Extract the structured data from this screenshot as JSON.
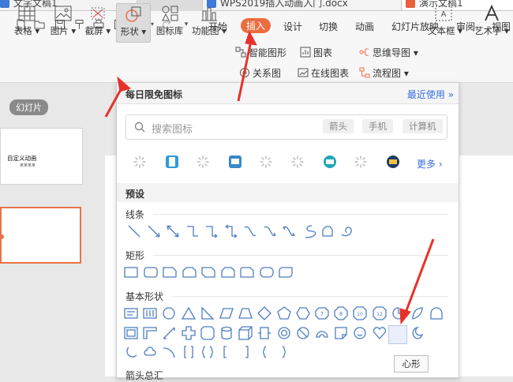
{
  "tabs": [
    {
      "label": "文字文稿1",
      "active": false
    },
    {
      "label": "WPS2019插入动画入门.docx",
      "active": false
    },
    {
      "label": "演示文稿1",
      "active": true
    }
  ],
  "menu": [
    "开始",
    "插入",
    "设计",
    "切换",
    "动画",
    "幻灯片放映",
    "审阅",
    "视图"
  ],
  "menu_active": "插入",
  "ribbon": {
    "table": "表格",
    "picture": "图片",
    "screenshot": "截屏",
    "shape": "形状",
    "icon_lib": "图标库",
    "function_chart": "功能图",
    "smart_graphic": "智能图形",
    "chart": "图表",
    "relation_chart": "关系图",
    "online_chart": "在线图表",
    "mindmap": "思维导图",
    "flowchart": "流程图",
    "textbox": "文本框",
    "art_text": "艺术字"
  },
  "left_panel": {
    "tag": "幻灯片",
    "slide1_title": "自定义动画",
    "slide1_sub": "某某某某"
  },
  "shape_panel": {
    "title": "每日限免图标",
    "recent": "最近使用",
    "search_placeholder": "搜索图标",
    "chips": [
      "箭头",
      "手机",
      "计算机"
    ],
    "more": "更多",
    "preset_label": "预设",
    "sections": {
      "lines": "线条",
      "rect": "矩形",
      "basic": "基本形状",
      "arrows": "箭头总汇"
    },
    "tooltip": "心形"
  },
  "colors": {
    "accent": "#ea6c3f",
    "link": "#3a6ee0",
    "shape_stroke": "#4e7fc1",
    "annotation_arrow": "#e8312a"
  }
}
